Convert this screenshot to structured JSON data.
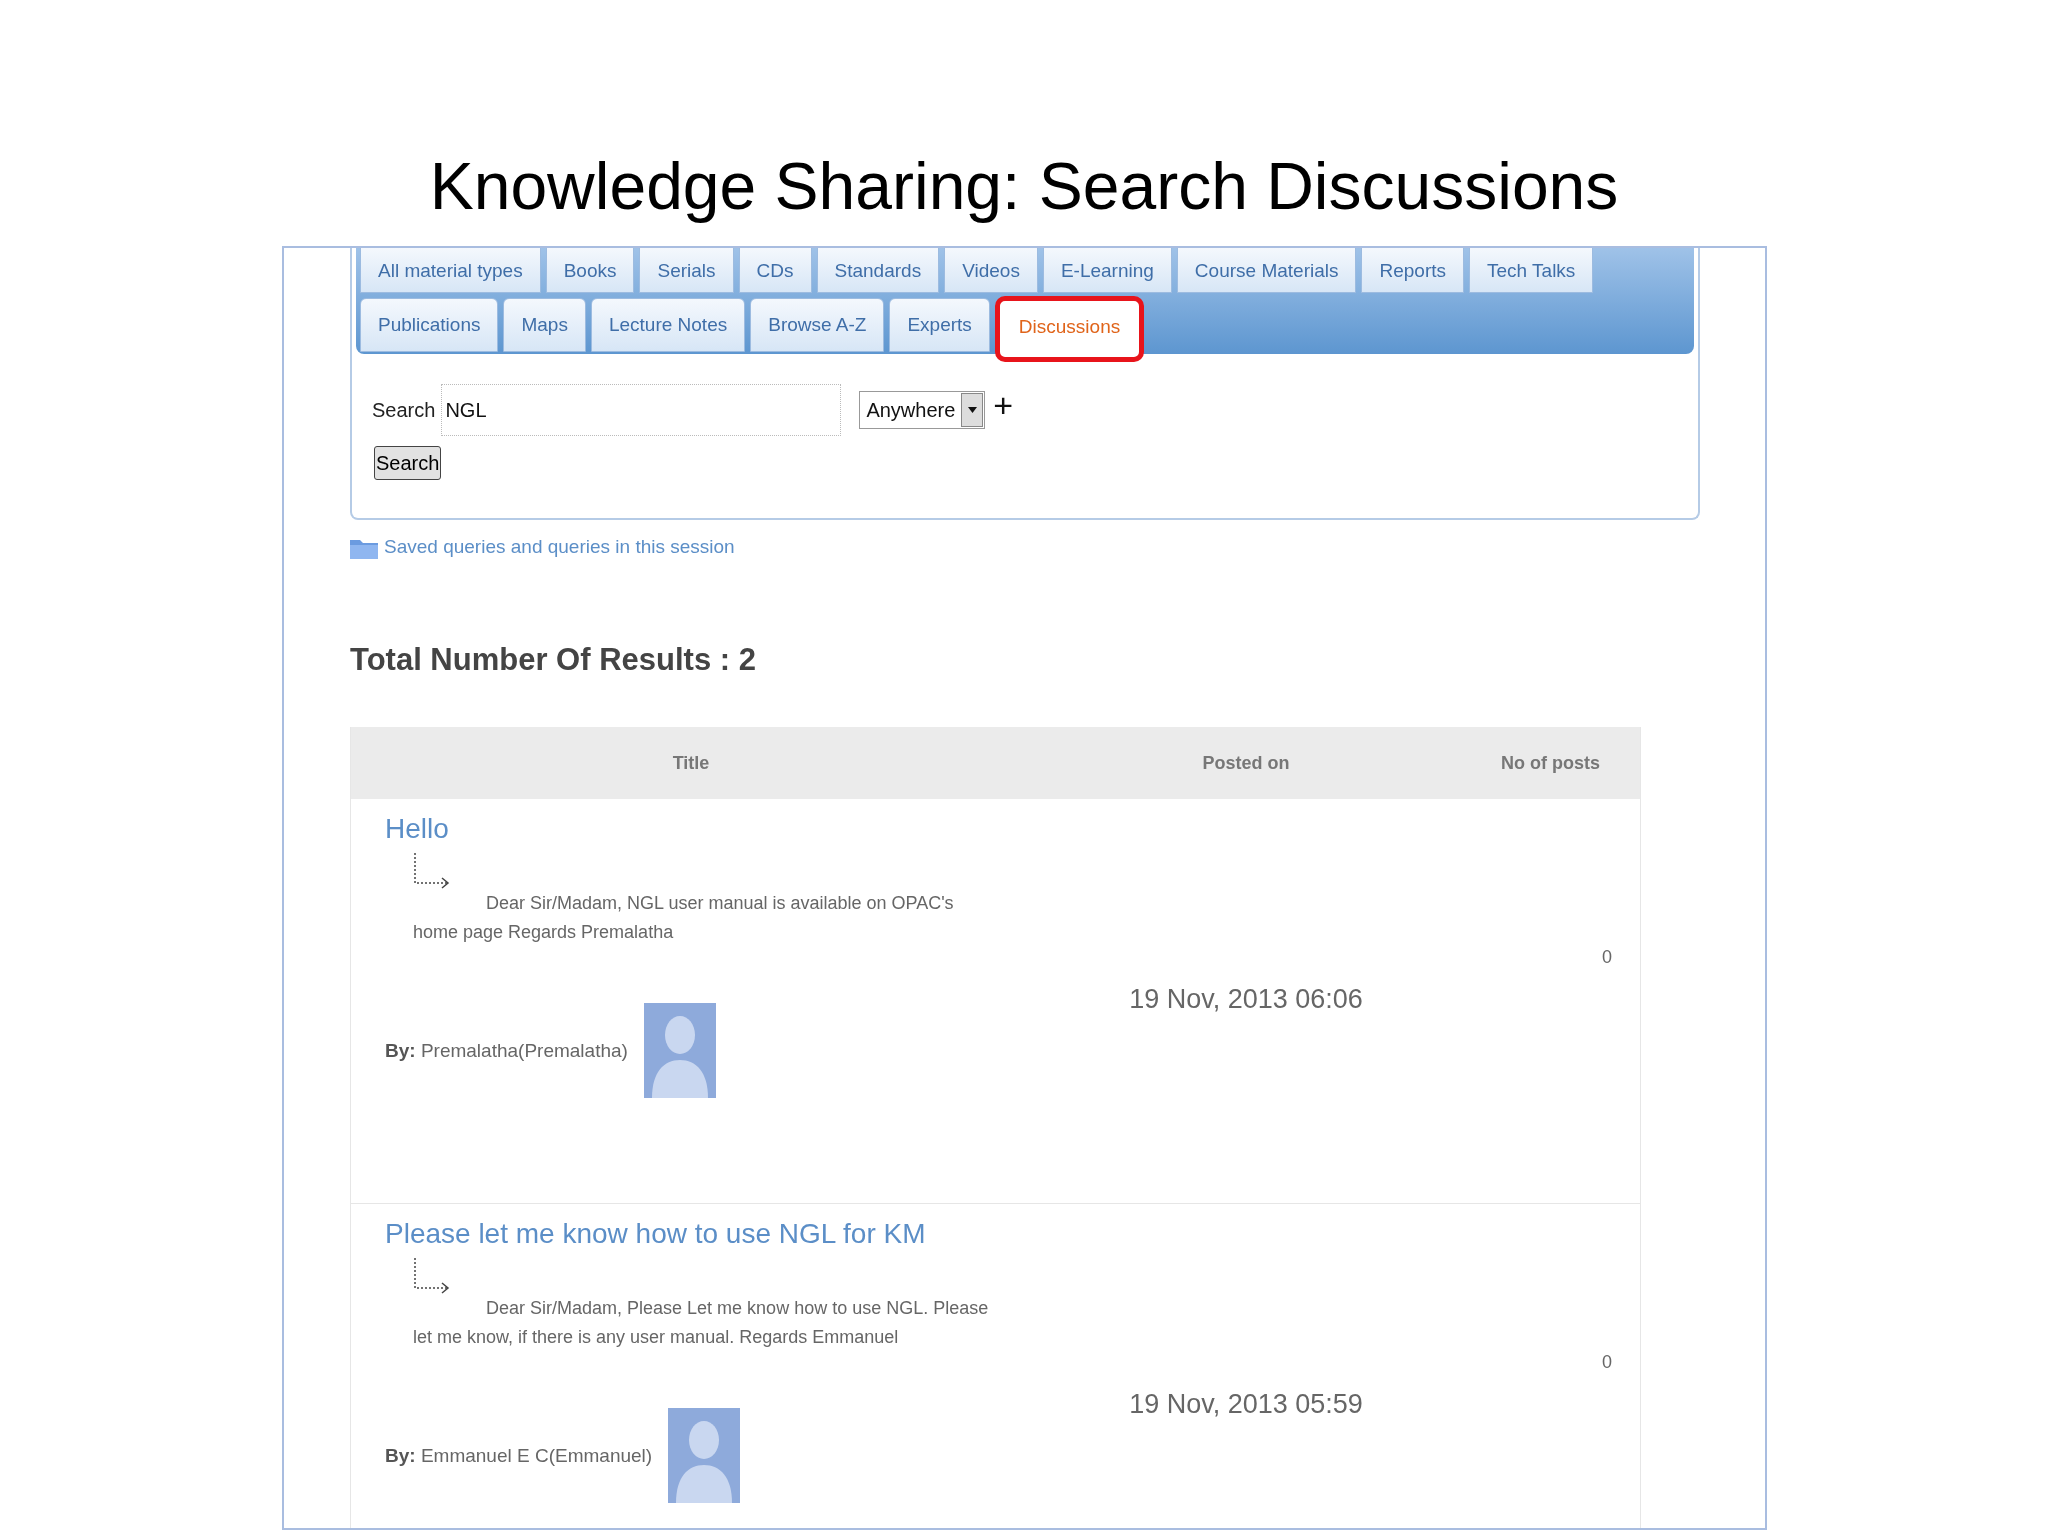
{
  "slide_title": "Knowledge Sharing: Search Discussions",
  "tab_rows": [
    {
      "tabs": [
        {
          "label": "All material types",
          "selected": false,
          "highlighted": false
        },
        {
          "label": "Books",
          "selected": false,
          "highlighted": false
        },
        {
          "label": "Serials",
          "selected": false,
          "highlighted": false
        },
        {
          "label": "CDs",
          "selected": false,
          "highlighted": false
        },
        {
          "label": "Standards",
          "selected": false,
          "highlighted": false
        },
        {
          "label": "Videos",
          "selected": false,
          "highlighted": false
        },
        {
          "label": "E-Learning",
          "selected": false,
          "highlighted": false
        },
        {
          "label": "Course Materials",
          "selected": false,
          "highlighted": false
        },
        {
          "label": "Reports",
          "selected": false,
          "highlighted": false
        },
        {
          "label": "Tech Talks",
          "selected": false,
          "highlighted": false
        }
      ]
    },
    {
      "tabs": [
        {
          "label": "Publications",
          "selected": false,
          "highlighted": false
        },
        {
          "label": "Maps",
          "selected": false,
          "highlighted": false
        },
        {
          "label": "Lecture Notes",
          "selected": false,
          "highlighted": false
        },
        {
          "label": "Browse A-Z",
          "selected": false,
          "highlighted": false
        },
        {
          "label": "Experts",
          "selected": false,
          "highlighted": false
        },
        {
          "label": "Discussions",
          "selected": true,
          "highlighted": true
        }
      ]
    }
  ],
  "search": {
    "label": "Search",
    "value": "NGL",
    "scope": "Anywhere",
    "add": "+",
    "button": "Search"
  },
  "saved_queries_link": "Saved queries and queries in this session",
  "results_heading": "Total Number Of Results : 2",
  "table": {
    "columns": [
      "Title",
      "Posted on",
      "No of posts"
    ],
    "rows": [
      {
        "title": "Hello",
        "snippet": "Dear Sir/Madam, NGL user manual is available on OPAC's home page Regards Premalatha",
        "byline": "**By:** Premalatha(Premalatha)",
        "posted_on": "19 Nov, 2013 06:06",
        "posts": "0"
      },
      {
        "title": "Please let me know how to use NGL for KM",
        "snippet": "Dear Sir/Madam, Please Let me know how to use NGL. Please let me know, if there is any user manual. Regards Emmanuel",
        "byline": "**By:** Emmanuel E C(Emmanuel)",
        "posted_on": "19 Nov, 2013 05:59",
        "posts": "0"
      }
    ]
  }
}
